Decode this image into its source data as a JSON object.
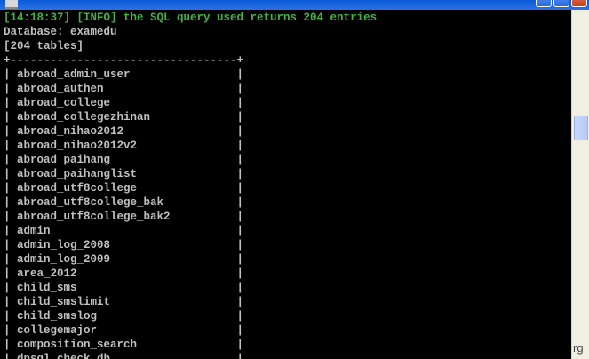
{
  "window": {
    "title": ""
  },
  "console": {
    "lines": [
      {
        "text": "[14:18:37] [INFO] the SQL query used returns 204 entries",
        "kind": "info"
      },
      {
        "text": "Database: examedu",
        "kind": "normal"
      },
      {
        "text": "[204 tables]",
        "kind": "normal"
      },
      {
        "text": "+----------------------------------+",
        "kind": "normal"
      },
      {
        "text": "| abroad_admin_user                |",
        "kind": "normal"
      },
      {
        "text": "| abroad_authen                    |",
        "kind": "normal"
      },
      {
        "text": "| abroad_college                   |",
        "kind": "normal"
      },
      {
        "text": "| abroad_collegezhinan             |",
        "kind": "normal"
      },
      {
        "text": "| abroad_nihao2012                 |",
        "kind": "normal"
      },
      {
        "text": "| abroad_nihao2012v2               |",
        "kind": "normal"
      },
      {
        "text": "| abroad_paihang                   |",
        "kind": "normal"
      },
      {
        "text": "| abroad_paihanglist               |",
        "kind": "normal"
      },
      {
        "text": "| abroad_utf8college               |",
        "kind": "normal"
      },
      {
        "text": "| abroad_utf8college_bak           |",
        "kind": "normal"
      },
      {
        "text": "| abroad_utf8college_bak2          |",
        "kind": "normal"
      },
      {
        "text": "| admin                            |",
        "kind": "normal"
      },
      {
        "text": "| admin_log_2008                   |",
        "kind": "normal"
      },
      {
        "text": "| admin_log_2009                   |",
        "kind": "normal"
      },
      {
        "text": "| area_2012                        |",
        "kind": "normal"
      },
      {
        "text": "| child_sms                        |",
        "kind": "normal"
      },
      {
        "text": "| child_smslimit                   |",
        "kind": "normal"
      },
      {
        "text": "| child_smslog                     |",
        "kind": "normal"
      },
      {
        "text": "| collegemajor                     |",
        "kind": "normal"
      },
      {
        "text": "| composition_search               |",
        "kind": "normal"
      },
      {
        "text": "| dpsql_check_db                   |",
        "kind": "normal"
      }
    ]
  },
  "corner_text": "rg",
  "colors": {
    "background": "#000000",
    "text": "#c0c0c0",
    "info": "#3fb43f"
  }
}
